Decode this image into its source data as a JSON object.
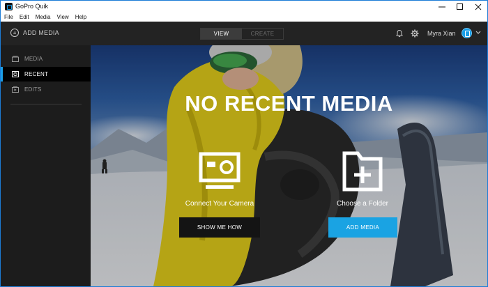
{
  "window": {
    "title": "GoPro Quik",
    "menu": [
      "File",
      "Edit",
      "Media",
      "View",
      "Help"
    ]
  },
  "header": {
    "add_media": "ADD MEDIA",
    "tabs": [
      {
        "label": "VIEW",
        "active": true
      },
      {
        "label": "CREATE",
        "active": false
      }
    ],
    "user_name": "Myra Xian"
  },
  "sidebar": {
    "items": [
      {
        "label": "MEDIA",
        "icon": "media-icon",
        "active": false
      },
      {
        "label": "RECENT",
        "icon": "recent-icon",
        "active": true
      },
      {
        "label": "EDITS",
        "icon": "edits-icon",
        "active": false
      }
    ]
  },
  "hero": {
    "title": "NO RECENT MEDIA",
    "camera_caption": "Connect Your Camera",
    "camera_button": "SHOW ME HOW",
    "folder_caption": "Choose a Folder",
    "folder_button": "ADD MEDIA"
  },
  "colors": {
    "accent": "#1aa3e3",
    "appbar": "#232323",
    "sidebar": "#1c1c1c"
  }
}
